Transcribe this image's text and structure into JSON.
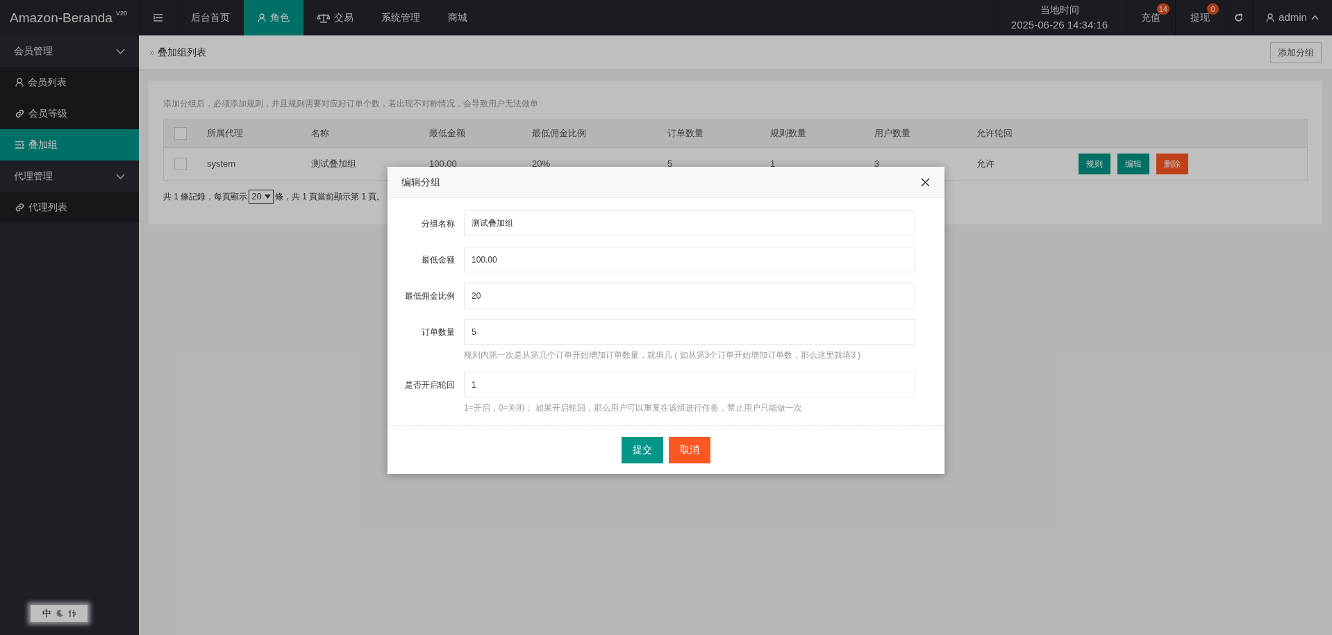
{
  "app": {
    "logo": "Amazon-Beranda",
    "version": "V20"
  },
  "top_nav": [
    {
      "label": "后台首页",
      "kind": "plain",
      "selected": false
    },
    {
      "label": "角色",
      "kind": "person",
      "selected": true
    },
    {
      "label": "交易",
      "kind": "trade",
      "selected": false
    },
    {
      "label": "系统管理",
      "kind": "plain",
      "selected": false
    },
    {
      "label": "商城",
      "kind": "plain",
      "selected": false
    }
  ],
  "clock": {
    "label": "当地时间",
    "time": "2025-06-26 14:34:16"
  },
  "top_actions": [
    {
      "label": "充值",
      "badge": "14"
    },
    {
      "label": "提现",
      "badge": "0"
    }
  ],
  "user": {
    "name": "admin"
  },
  "sidebar": [
    {
      "label": "会员管理",
      "expanded": true,
      "children": [
        {
          "label": "会员列表",
          "kind": "person",
          "selected": false
        },
        {
          "label": "会员等级",
          "kind": "linked",
          "selected": false
        },
        {
          "label": "叠加组",
          "kind": "group",
          "selected": true
        }
      ]
    },
    {
      "label": "代理管理",
      "expanded": true,
      "children": [
        {
          "label": "代理列表",
          "kind": "linked",
          "selected": false
        }
      ]
    }
  ],
  "breadcrumb": "叠加组列表",
  "add_button": "添加分组",
  "notice": "添加分组后，必须添加规则，并且规则需要对应好订单个数，若出现不对称情况，会导致用户无法做单",
  "table": {
    "all_checked": false,
    "columns": [
      "所属代理",
      "名称",
      "最低金额",
      "最低佣金比例",
      "订单数量",
      "规则数量",
      "用户数量",
      "允许轮回"
    ],
    "rows": [
      {
        "checked": false,
        "cells": [
          "system",
          "测试叠加组",
          "100.00",
          "20%",
          "5",
          "1",
          "3",
          "允许"
        ],
        "actions": [
          {
            "label": "规则",
            "kind": "primary"
          },
          {
            "label": "编辑",
            "kind": "primary"
          },
          {
            "label": "删除",
            "kind": "danger"
          }
        ]
      }
    ]
  },
  "pagination": {
    "before": "共 1 條記錄，每頁顯示",
    "page_size": "20",
    "after": "條，共 1 頁當前顯示第 1 頁。"
  },
  "ime": {
    "label": "中"
  },
  "dialog": {
    "title": "编辑分组",
    "fields": [
      {
        "label": "分组名称",
        "value": "测试叠加组"
      },
      {
        "label": "最低金额",
        "value": "100.00"
      },
      {
        "label": "最低佣金比例",
        "value": "20"
      },
      {
        "label": "订单数量",
        "value": "5",
        "hint": "规则内第一次是从第几个订单开始增加订单数量，就填几 ( 如从第3个订单开始增加订单数，那么这里就填3 )"
      },
      {
        "label": "是否开启轮回",
        "value": "1",
        "hint": "1=开启，0=关闭； 如果开启轮回，那么用户可以重复在该组进行任务，禁止用户只能做一次"
      }
    ],
    "buttons": [
      {
        "label": "提交",
        "kind": "primary"
      },
      {
        "label": "取消",
        "kind": "danger"
      }
    ]
  }
}
